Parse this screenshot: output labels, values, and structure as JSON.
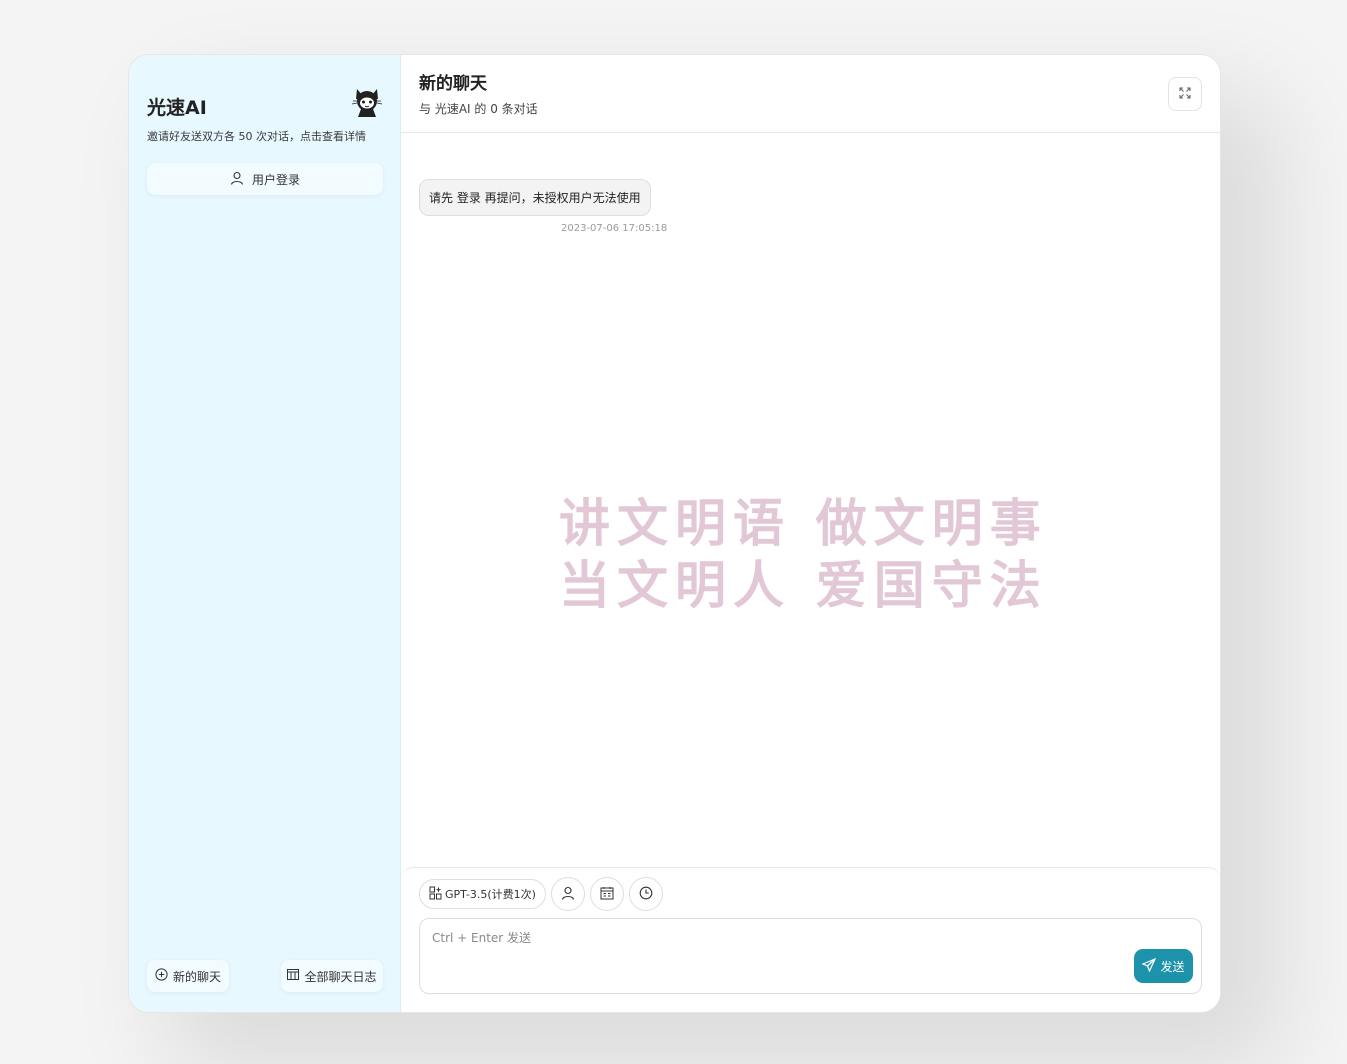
{
  "colors": {
    "sidebar_bg": "#e7f8ff",
    "accent": "#1d93ab",
    "watermark": "#e2c8d6"
  },
  "sidebar": {
    "title": "光速AI",
    "subtitle": "邀请好友送双方各 50 次对话，点击查看详情",
    "logo_icon": "cat-mascot-icon",
    "login_label": "用户登录",
    "login_icon": "user-icon",
    "new_chat_label": "新的聊天",
    "new_chat_icon": "plus-circle-icon",
    "all_logs_label": "全部聊天日志",
    "all_logs_icon": "table-icon"
  },
  "header": {
    "title": "新的聊天",
    "subtitle": "与 光速AI 的 0 条对话",
    "expand_icon": "expand-icon"
  },
  "messages": [
    {
      "role": "assistant",
      "text": "请先 登录 再提问，未授权用户无法使用",
      "time": "2023-07-06 17:05:18"
    }
  ],
  "watermark": {
    "line1": "讲文明语 做文明事",
    "line2": "当文明人 爱国守法"
  },
  "input": {
    "model_label": "GPT-3.5(计费1次)",
    "model_icon": "apps-icon",
    "tools": [
      "user-icon",
      "calendar-icon",
      "clock-icon"
    ],
    "placeholder": "Ctrl + Enter 发送",
    "send_label": "发送",
    "send_icon": "send-icon"
  }
}
